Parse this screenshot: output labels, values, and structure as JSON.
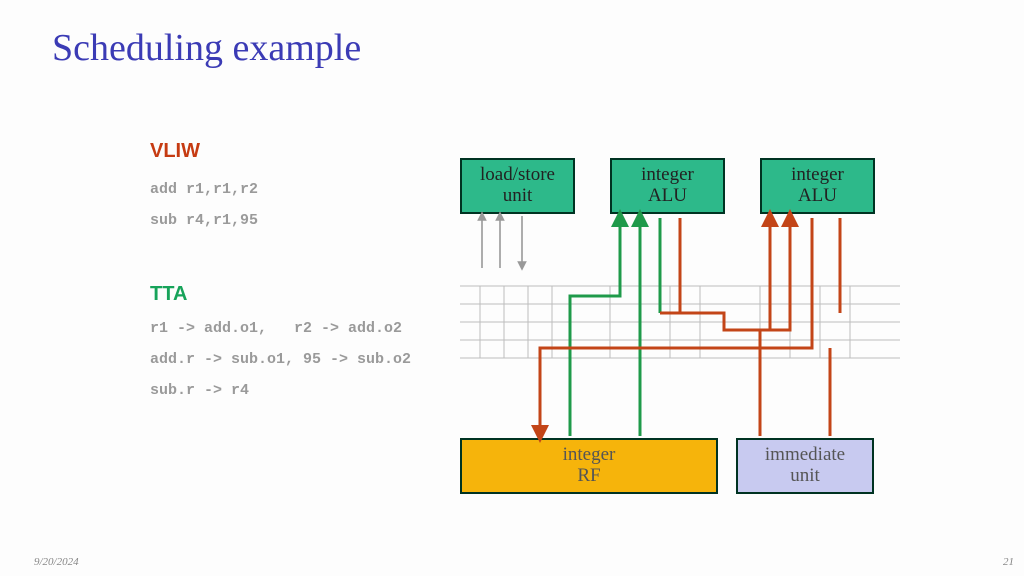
{
  "title": "Scheduling example",
  "footer": {
    "date": "9/20/2024",
    "page": "21"
  },
  "col": {
    "vliw_hdr": "VLIW",
    "vliw1": "add r1,r1,r2",
    "vliw2": "sub r4,r1,95",
    "tta_hdr": "TTA",
    "tta1": "r1 -> add.o1,   r2 -> add.o2",
    "tta2": "add.r -> sub.o1, 95 -> sub.o2",
    "tta3": "sub.r -> r4"
  },
  "units": {
    "ls": "load/store\nunit",
    "alu1": "integer\nALU",
    "alu2": "integer\nALU",
    "rf": "integer\nRF",
    "imm": "immediate\nunit"
  },
  "colors": {
    "title": "#3b3bb5",
    "vliw": "#c63b12",
    "tta": "#17a35a",
    "unit_green": "#2db98a",
    "unit_yellow": "#f6b40b",
    "unit_lavender": "#c8caf0",
    "wire_green": "#1f9a4a",
    "wire_red": "#c34518",
    "wire_gray": "#999"
  }
}
